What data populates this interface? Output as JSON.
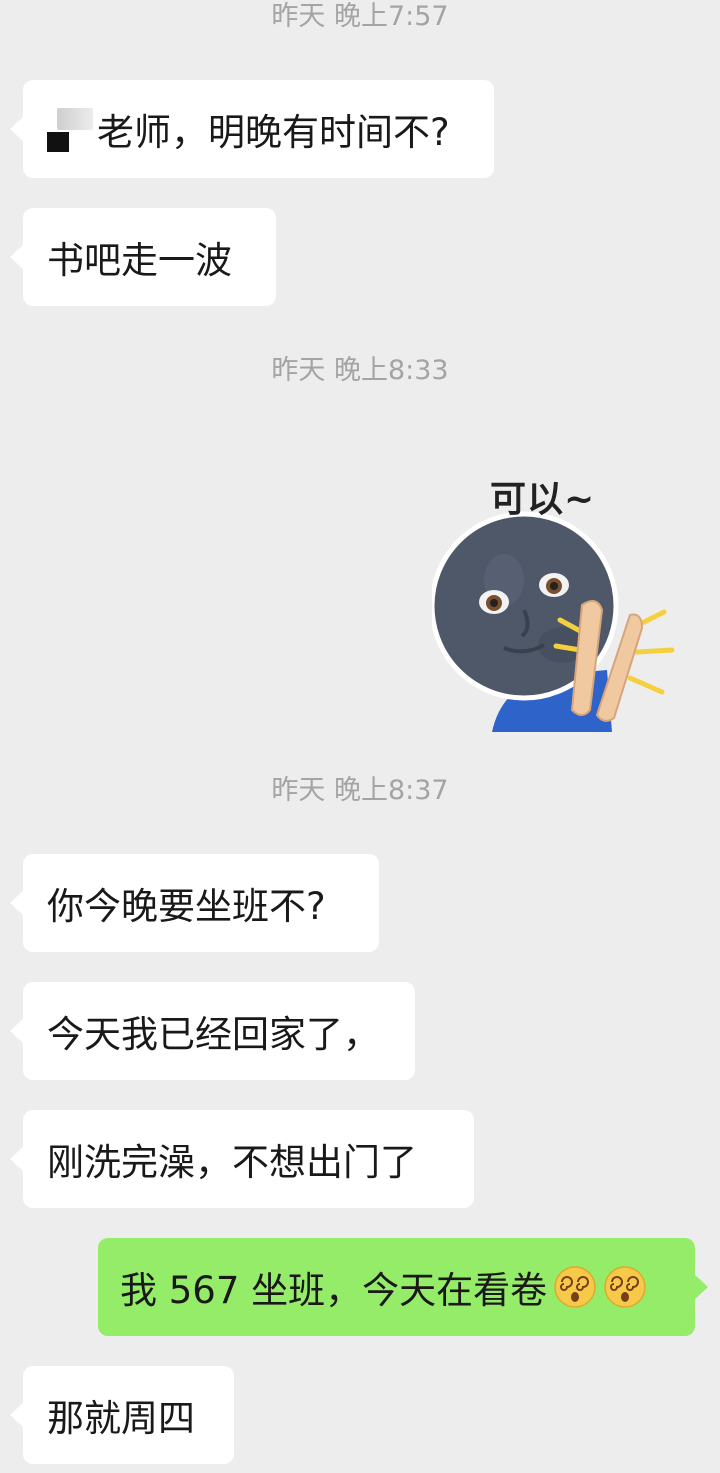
{
  "chat": {
    "timestamps": [
      "昨天 晚上7:57",
      "昨天 晚上8:33",
      "昨天 晚上8:37"
    ],
    "messages": [
      {
        "side": "in",
        "text": "老师，明晚有时间不?"
      },
      {
        "side": "in",
        "text": "书吧走一波"
      },
      {
        "side": "in",
        "type": "sticker",
        "text": "可以~"
      },
      {
        "side": "in",
        "text": "你今晚要坐班不?"
      },
      {
        "side": "in",
        "text": "今天我已经回家了，"
      },
      {
        "side": "in",
        "text": "刚洗完澡，不想出门了"
      },
      {
        "side": "out",
        "text": "我 567 坐班，今天在看卷",
        "emojis": [
          "dizzy-face-emoji",
          "dizzy-face-emoji"
        ]
      },
      {
        "side": "in",
        "text": "那就周四"
      }
    ]
  },
  "colors": {
    "background": "#ededed",
    "incoming_bubble": "#ffffff",
    "outgoing_bubble": "#95ec69",
    "timestamp_text": "#a4a4a4",
    "message_text": "#191919"
  }
}
